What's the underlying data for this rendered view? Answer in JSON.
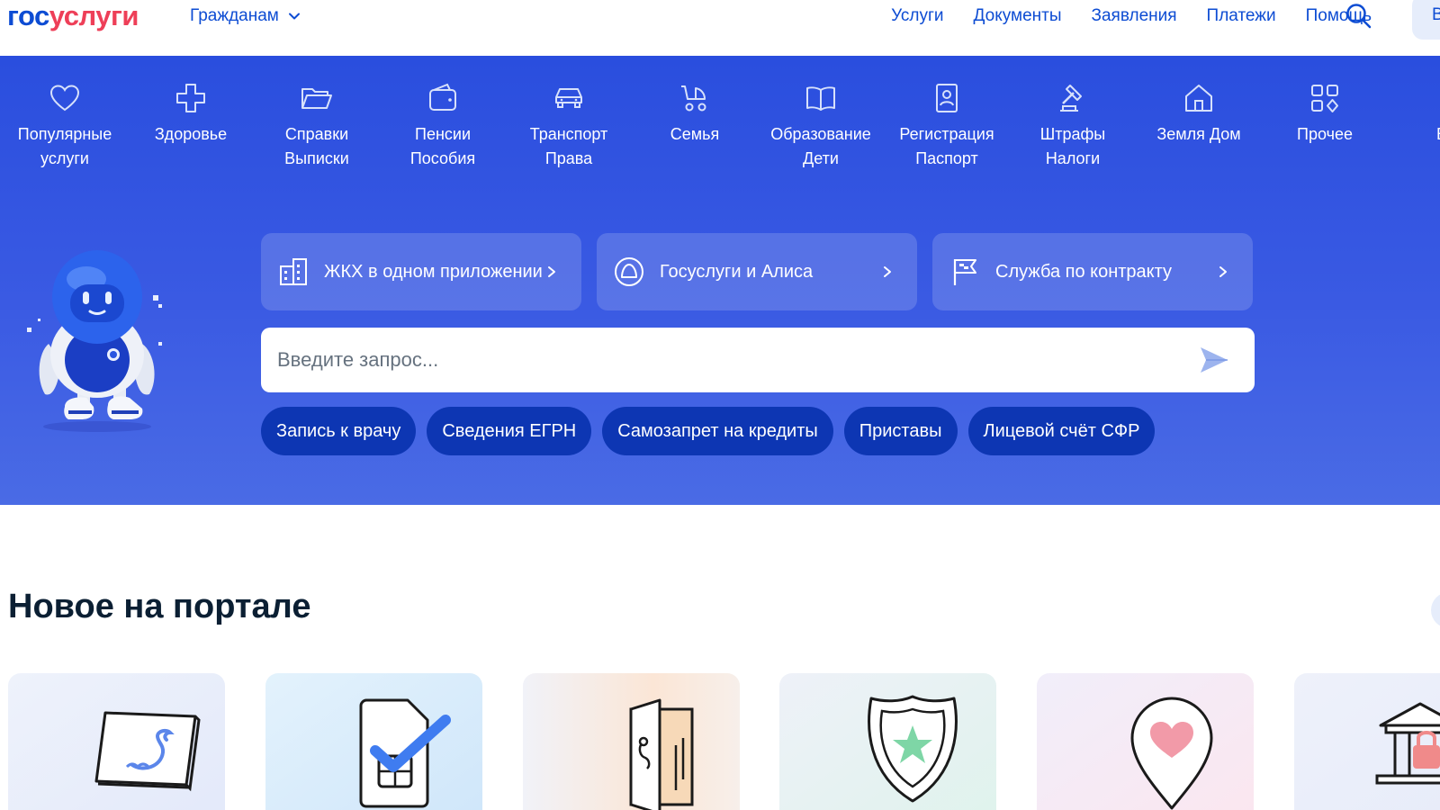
{
  "header": {
    "logo_part1": "гос",
    "logo_part2": "услуги",
    "audience": "Гражданам",
    "nav": [
      "Услуги",
      "Документы",
      "Заявления",
      "Платежи",
      "Помощь"
    ],
    "login_partial": "В"
  },
  "categories": [
    {
      "label": "Популярные\nуслуги",
      "icon": "heart-icon"
    },
    {
      "label": "Здоровье",
      "icon": "plus-cross-icon"
    },
    {
      "label": "Справки\nВыписки",
      "icon": "folder-icon"
    },
    {
      "label": "Пенсии\nПособия",
      "icon": "wallet-icon"
    },
    {
      "label": "Транспорт\nПрава",
      "icon": "car-icon"
    },
    {
      "label": "Семья",
      "icon": "stroller-icon"
    },
    {
      "label": "Образование\nДети",
      "icon": "book-icon"
    },
    {
      "label": "Регистрация\nПаспорт",
      "icon": "passport-icon"
    },
    {
      "label": "Штрафы\nНалоги",
      "icon": "gavel-icon"
    },
    {
      "label": "Земля Дом",
      "icon": "house-icon"
    },
    {
      "label": "Прочее",
      "icon": "grid-icon"
    },
    {
      "label": "Вед",
      "icon": "partial-icon"
    }
  ],
  "promos": [
    {
      "label": "ЖКХ в одном приложении",
      "icon": "building-icon"
    },
    {
      "label": "Госуслуги и Алиса",
      "icon": "alice-icon"
    },
    {
      "label": "Служба по контракту",
      "icon": "flag-icon"
    }
  ],
  "search": {
    "placeholder": "Введите запрос..."
  },
  "chips": [
    "Запись к врачу",
    "Сведения ЕГРН",
    "Самозапрет на кредиты",
    "Приставы",
    "Лицевой счёт СФР"
  ],
  "new_section": {
    "title": "Новое на портале",
    "cards": [
      {
        "icon": "postcard-icon"
      },
      {
        "icon": "sim-card-check-icon"
      },
      {
        "icon": "door-icon"
      },
      {
        "icon": "shield-star-icon"
      },
      {
        "icon": "location-heart-icon"
      },
      {
        "icon": "bank-lock-icon"
      }
    ]
  },
  "colors": {
    "brand_blue": "#0d4cd3",
    "brand_red": "#ee3f58",
    "hero_blue": "#2a4ede",
    "chip_blue": "#0d36b3"
  }
}
